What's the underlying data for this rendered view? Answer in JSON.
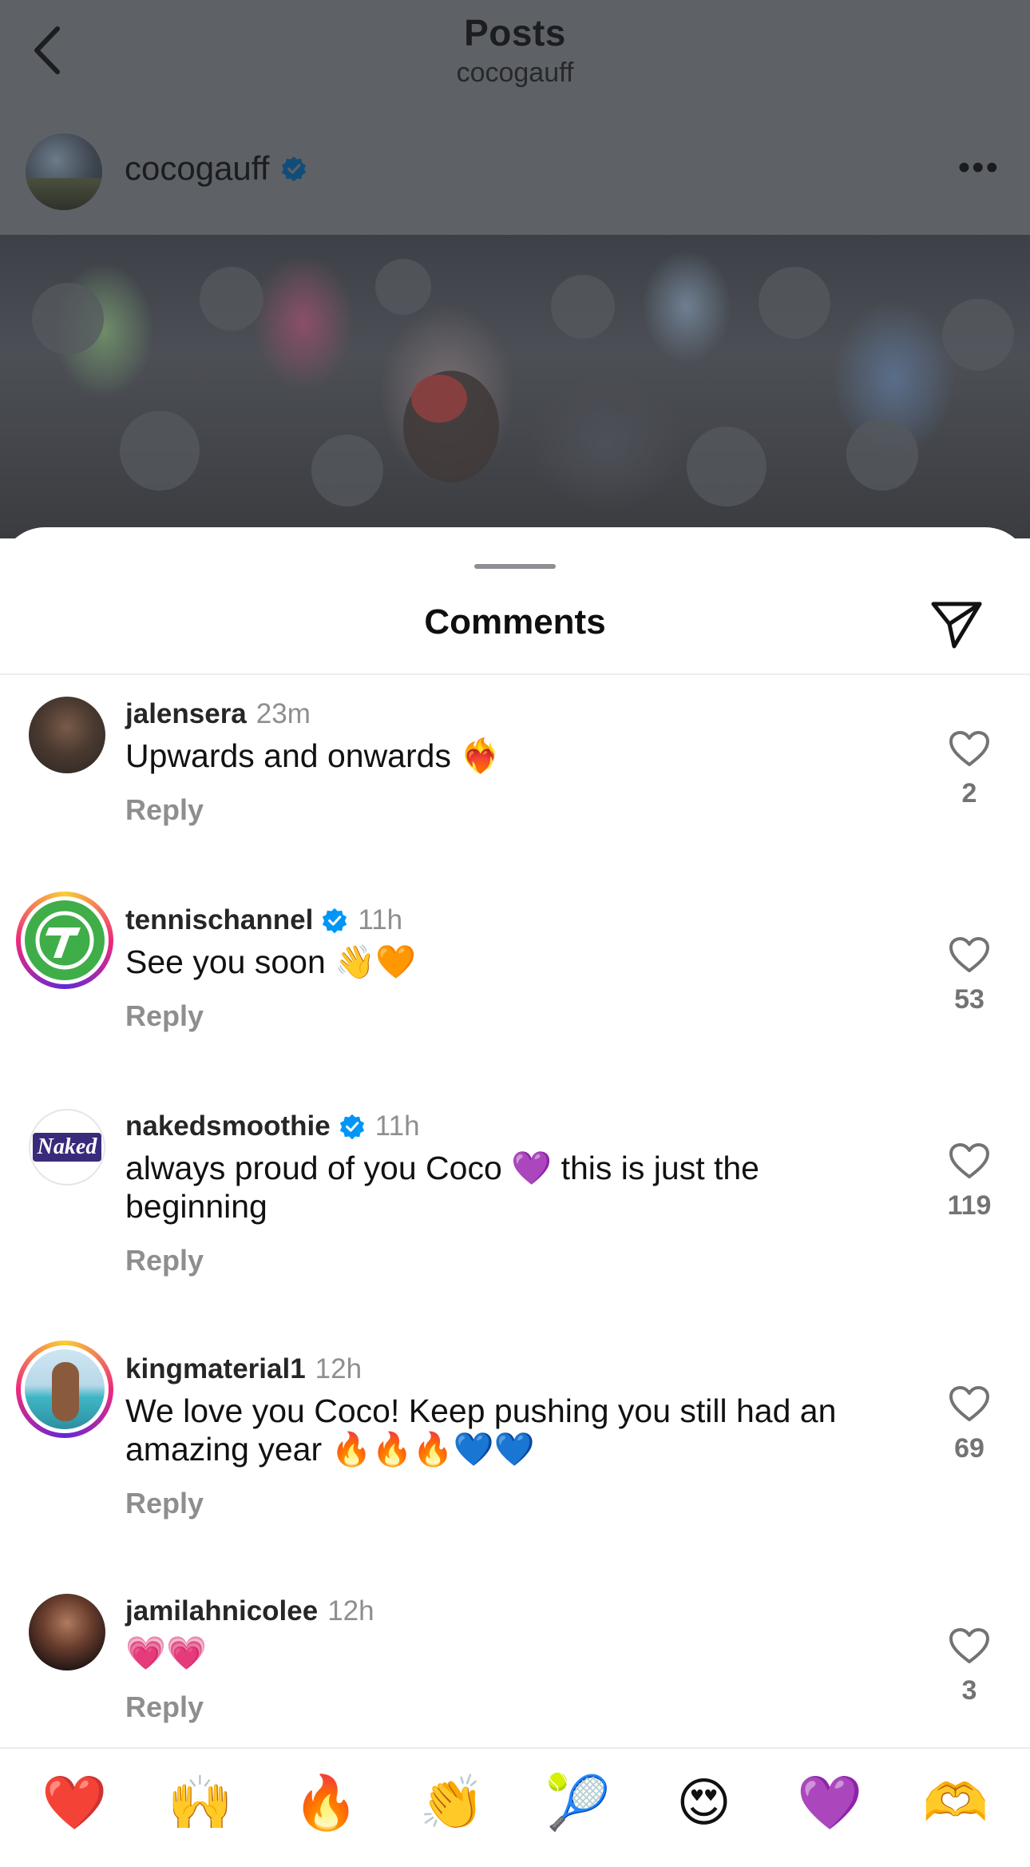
{
  "header": {
    "title": "Posts",
    "subtitle": "cocogauff"
  },
  "post": {
    "username": "cocogauff",
    "verified": true
  },
  "sheet": {
    "title": "Comments"
  },
  "comments": [
    {
      "user": "jalensera",
      "verified": false,
      "time": "23m",
      "text": "Upwards and onwards ❤️‍🔥",
      "reply": "Reply",
      "likes": "2"
    },
    {
      "user": "tennischannel",
      "verified": true,
      "time": "11h",
      "text": "See you soon 👋🧡",
      "reply": "Reply",
      "likes": "53"
    },
    {
      "user": "nakedsmoothie",
      "verified": true,
      "time": "11h",
      "text": "always proud of you Coco 💜 this is just the beginning",
      "reply": "Reply",
      "likes": "119",
      "avatar_text": "Naked"
    },
    {
      "user": "kingmaterial1",
      "verified": false,
      "time": "12h",
      "text": "We love you Coco! Keep pushing you still had an amazing year 🔥🔥🔥💙💙",
      "reply": "Reply",
      "likes": "69"
    },
    {
      "user": "jamilahnicolee",
      "verified": false,
      "time": "12h",
      "text": "💗💗",
      "reply": "Reply",
      "likes": "3"
    }
  ],
  "emoji_bar": [
    "❤️",
    "🙌",
    "🔥",
    "👏",
    "🎾",
    "😍",
    "💜",
    "🫶"
  ],
  "colors": {
    "verified_blue": "#0095f6",
    "dim_overlay": "#5e6166",
    "secondary_text": "#8e8e8e",
    "tennischannel_green": "#3fae49"
  }
}
